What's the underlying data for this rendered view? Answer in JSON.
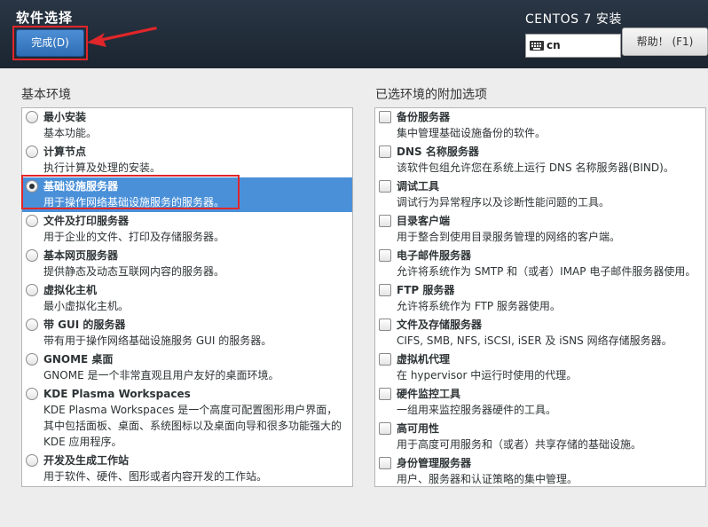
{
  "header": {
    "page_title": "软件选择",
    "done_button_label": "完成(D)",
    "product_title": "CENTOS 7 安装",
    "keyboard_layout": "cn",
    "help_button_label": "帮助！ (F1)"
  },
  "base_environment": {
    "label": "基本环境",
    "items": [
      {
        "title": "最小安装",
        "desc": "基本功能。",
        "selected": false
      },
      {
        "title": "计算节点",
        "desc": "执行计算及处理的安装。",
        "selected": false
      },
      {
        "title": "基础设施服务器",
        "desc": "用于操作网络基础设施服务的服务器。",
        "selected": true
      },
      {
        "title": "文件及打印服务器",
        "desc": "用于企业的文件、打印及存储服务器。",
        "selected": false
      },
      {
        "title": "基本网页服务器",
        "desc": "提供静态及动态互联网内容的服务器。",
        "selected": false
      },
      {
        "title": "虚拟化主机",
        "desc": "最小虚拟化主机。",
        "selected": false
      },
      {
        "title": "带 GUI 的服务器",
        "desc": "带有用于操作网络基础设施服务 GUI 的服务器。",
        "selected": false
      },
      {
        "title": "GNOME 桌面",
        "desc": "GNOME 是一个非常直观且用户友好的桌面环境。",
        "selected": false
      },
      {
        "title": "KDE Plasma Workspaces",
        "desc": "KDE Plasma Workspaces 是一个高度可配置图形用户界面，其中包括面板、桌面、系统图标以及桌面向导和很多功能强大的 KDE 应用程序。",
        "selected": false
      },
      {
        "title": "开发及生成工作站",
        "desc": "用于软件、硬件、图形或者内容开发的工作站。",
        "selected": false
      }
    ]
  },
  "addons": {
    "label": "已选环境的附加选项",
    "items": [
      {
        "title": "备份服务器",
        "desc": "集中管理基础设施备份的软件。",
        "checked": false
      },
      {
        "title": "DNS 名称服务器",
        "desc": "该软件包组允许您在系统上运行 DNS 名称服务器(BIND)。",
        "checked": false
      },
      {
        "title": "调试工具",
        "desc": "调试行为异常程序以及诊断性能问题的工具。",
        "checked": false
      },
      {
        "title": "目录客户端",
        "desc": "用于整合到使用目录服务管理的网络的客户端。",
        "checked": false
      },
      {
        "title": "电子邮件服务器",
        "desc": "允许将系统作为 SMTP 和（或者）IMAP 电子邮件服务器使用。",
        "checked": false
      },
      {
        "title": "FTP 服务器",
        "desc": "允许将系统作为 FTP 服务器使用。",
        "checked": false
      },
      {
        "title": "文件及存储服务器",
        "desc": "CIFS, SMB, NFS, iSCSI, iSER 及 iSNS 网络存储服务器。",
        "checked": false
      },
      {
        "title": "虚拟机代理",
        "desc": "在 hypervisor 中运行时使用的代理。",
        "checked": false
      },
      {
        "title": "硬件监控工具",
        "desc": "一组用来监控服务器硬件的工具。",
        "checked": false
      },
      {
        "title": "高可用性",
        "desc": "用于高度可用服务和（或者）共享存储的基础设施。",
        "checked": false
      },
      {
        "title": "身份管理服务器",
        "desc": "用户、服务器和认证策略的集中管理。",
        "checked": false
      }
    ]
  }
}
